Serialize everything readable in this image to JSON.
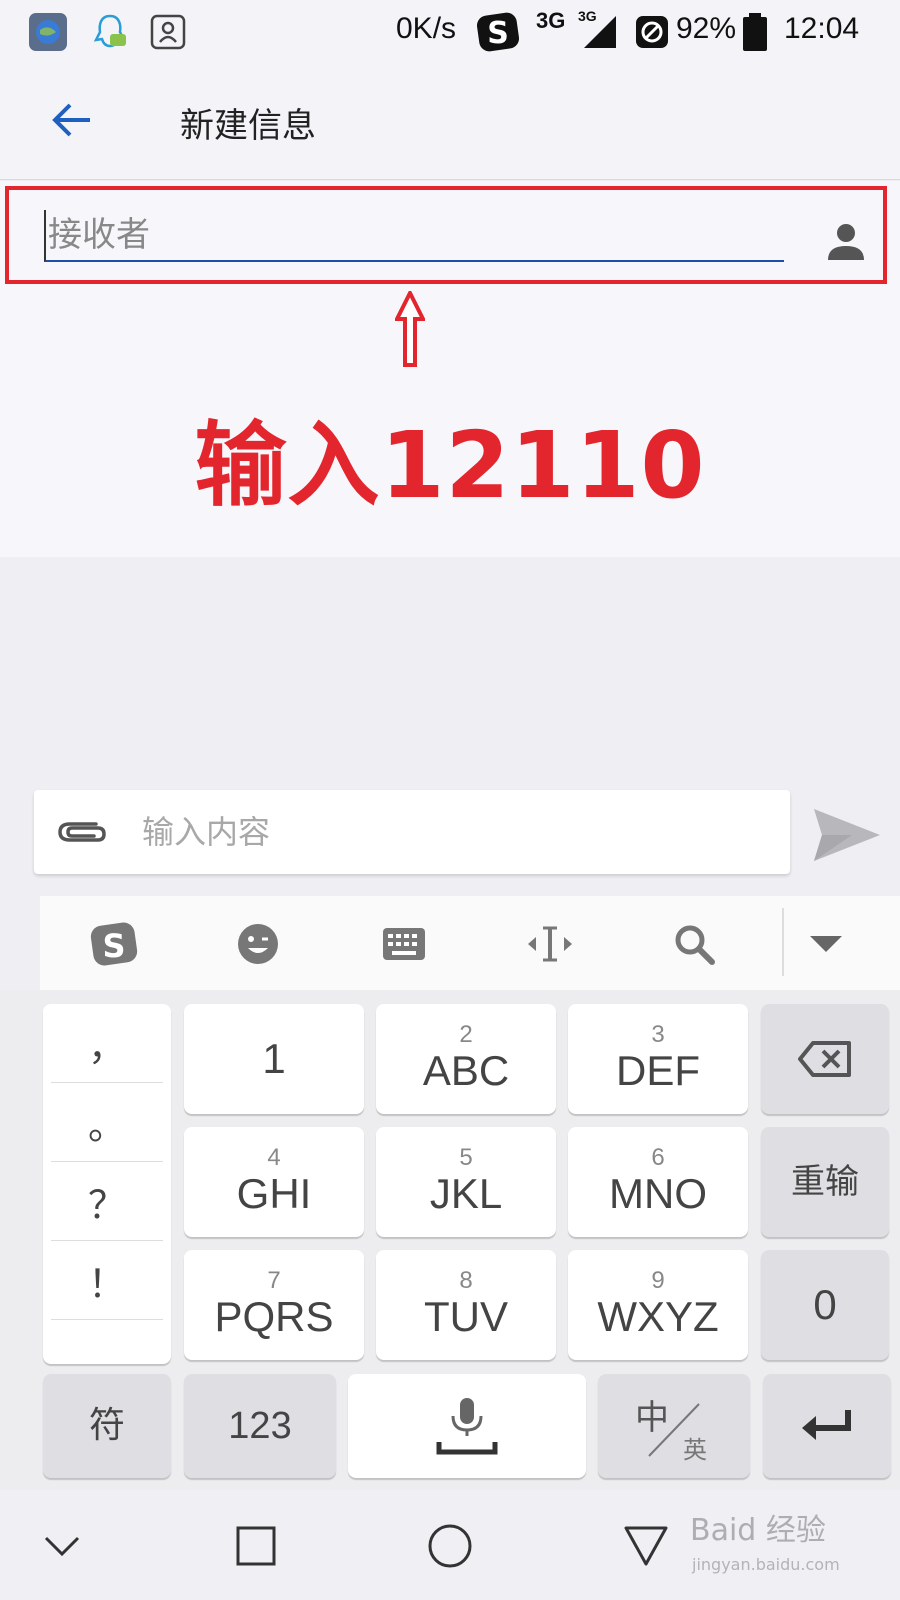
{
  "status_bar": {
    "net_speed": "0K/s",
    "network_a": "3G",
    "network_b": "3G",
    "battery": "92%",
    "time": "12:04",
    "icons": [
      "browser-icon",
      "qq-icon",
      "contacts-icon",
      "sogou-icon",
      "signal-icon",
      "block-icon",
      "battery-icon"
    ]
  },
  "app_bar": {
    "title": "新建信息",
    "back_icon": "arrow-left-icon"
  },
  "recipient": {
    "placeholder": "接收者",
    "value": "",
    "contact_icon": "person-icon"
  },
  "annotation": {
    "text": "输入12110",
    "color": "#e3262e"
  },
  "compose": {
    "placeholder": "输入内容",
    "attach_icon": "paperclip-icon",
    "send_icon": "send-icon"
  },
  "ime_toolbar": {
    "buttons": [
      "sogou-logo-icon",
      "emoji-icon",
      "keyboard-icon",
      "cursor-move-icon",
      "search-icon",
      "collapse-icon"
    ]
  },
  "keyboard": {
    "punctuation": [
      "，",
      "。",
      "？",
      "！"
    ],
    "keys": [
      {
        "num": "",
        "label": "1"
      },
      {
        "num": "2",
        "label": "ABC"
      },
      {
        "num": "3",
        "label": "DEF"
      },
      {
        "num": "4",
        "label": "GHI"
      },
      {
        "num": "5",
        "label": "JKL"
      },
      {
        "num": "6",
        "label": "MNO"
      },
      {
        "num": "7",
        "label": "PQRS"
      },
      {
        "num": "8",
        "label": "TUV"
      },
      {
        "num": "9",
        "label": "WXYZ"
      }
    ],
    "backspace_icon": "backspace-icon",
    "reenter": "重输",
    "zero": "0",
    "symbols": "符",
    "numeric": "123",
    "mic_icon": "microphone-icon",
    "lang_zh": "中",
    "lang_en": "英",
    "enter_icon": "enter-icon"
  },
  "nav_bar": {
    "buttons": [
      "chevron-down-icon",
      "recents-icon",
      "home-icon",
      "back-triangle-icon"
    ]
  },
  "watermark": {
    "text": "Baid 经验",
    "sub": "jingyan.baidu.com"
  }
}
